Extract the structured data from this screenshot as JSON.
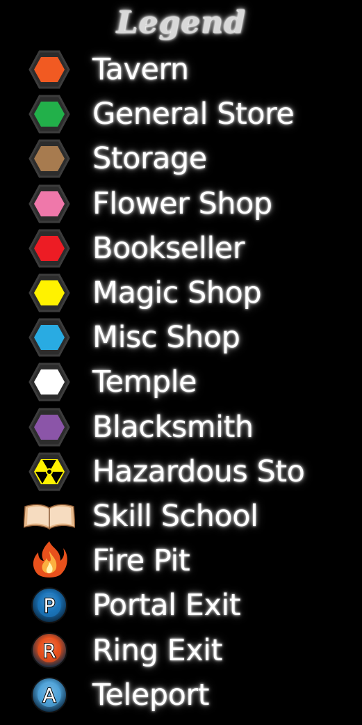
{
  "title": "Legend",
  "items": [
    {
      "label": "Tavern",
      "icon": "orange-hexagon-icon",
      "color": "#f15a22"
    },
    {
      "label": "General Store",
      "icon": "green-hexagon-icon",
      "color": "#22b04a"
    },
    {
      "label": "Storage",
      "icon": "brown-hexagon-icon",
      "color": "#a77b4f"
    },
    {
      "label": "Flower Shop",
      "icon": "pink-hexagon-icon",
      "color": "#ef78aa"
    },
    {
      "label": "Bookseller",
      "icon": "red-hexagon-icon",
      "color": "#ed1c24"
    },
    {
      "label": "Magic Shop",
      "icon": "yellow-hexagon-icon",
      "color": "#fff200"
    },
    {
      "label": "Misc Shop",
      "icon": "blue-hexagon-icon",
      "color": "#29abe2"
    },
    {
      "label": "Temple",
      "icon": "white-hexagon-icon",
      "color": "#ffffff"
    },
    {
      "label": "Blacksmith",
      "icon": "purple-hexagon-icon",
      "color": "#8b55a8"
    },
    {
      "label": "Hazardous Sto",
      "icon": "radiation-hexagon-icon",
      "color": "#fff200"
    },
    {
      "label": "Skill School",
      "icon": "open-book-icon",
      "color": "#f2c9a0"
    },
    {
      "label": "Fire Pit",
      "icon": "fire-icon",
      "color": "#f47920"
    },
    {
      "label": "Portal Exit",
      "icon": "portal-exit-icon",
      "color": "#1b75bb",
      "letter": "P"
    },
    {
      "label": "Ring Exit",
      "icon": "ring-exit-icon",
      "color": "#e8501c",
      "letter": "R"
    },
    {
      "label": "Teleport",
      "icon": "teleport-icon",
      "color": "#4fa3d9",
      "letter": "A"
    }
  ]
}
